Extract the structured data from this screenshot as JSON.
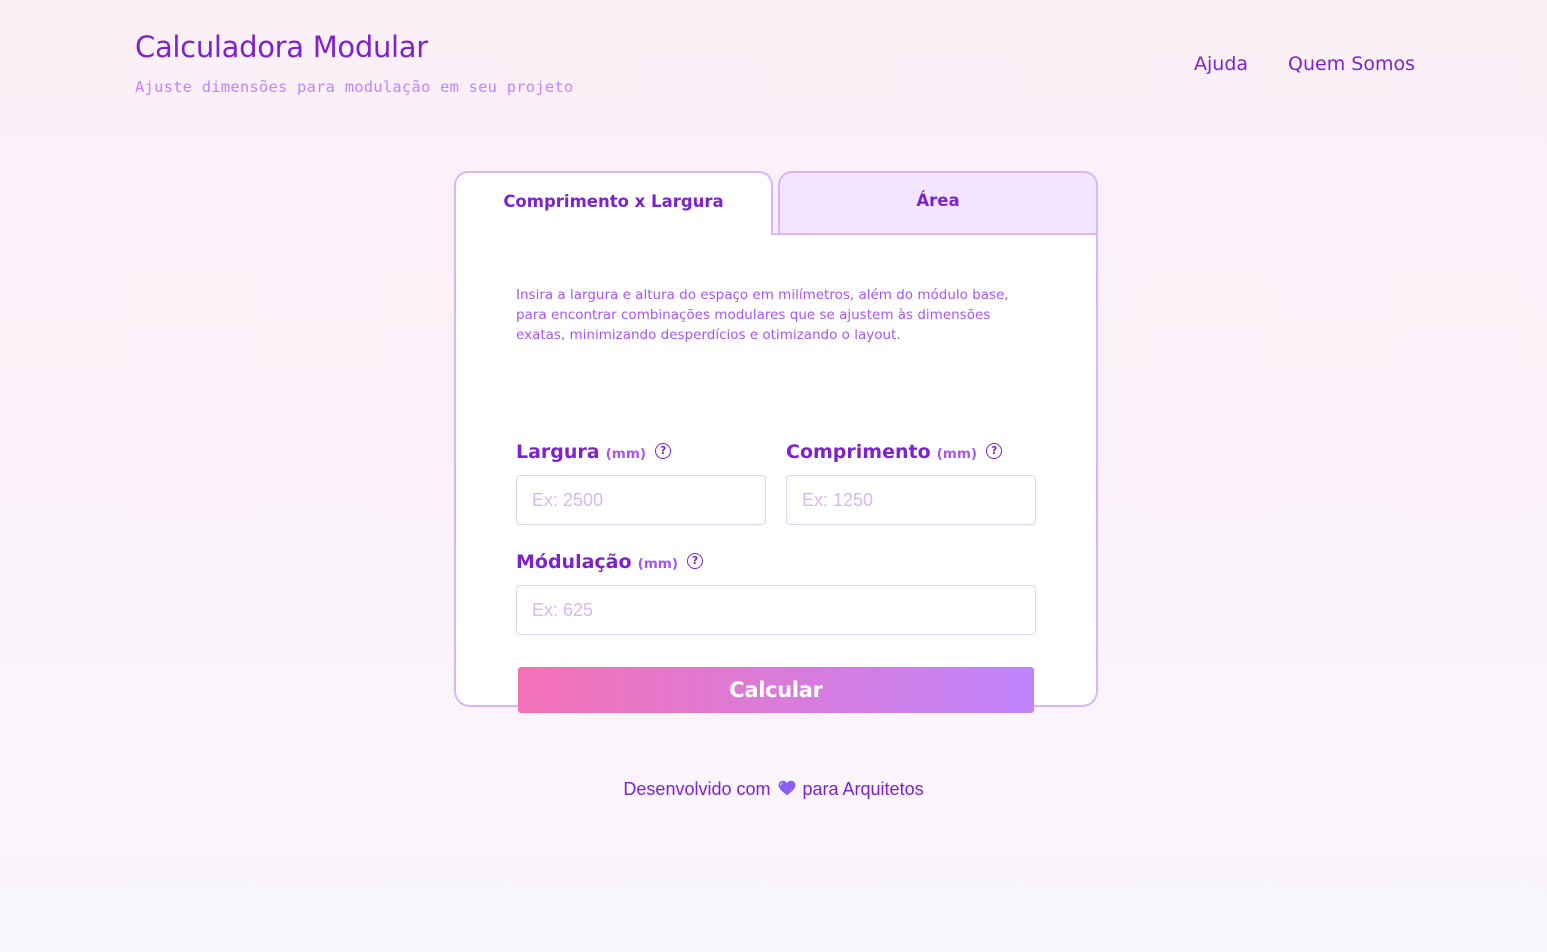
{
  "header": {
    "title": "Calculadora Modular",
    "subtitle": "Ajuste dimensões para modulação em seu projeto",
    "nav": [
      {
        "label": "Ajuda"
      },
      {
        "label": "Quem Somos"
      }
    ]
  },
  "tabs": [
    {
      "label": "Comprimento x Largura",
      "active": true
    },
    {
      "label": "Área",
      "active": false
    }
  ],
  "form": {
    "description": "Insira a largura e altura do espaço em milímetros, além do módulo base, para encontrar combinações modulares que se ajustem às dimensões exatas, minimizando desperdícios e otimizando o layout.",
    "fields": {
      "largura": {
        "label": "Largura",
        "unit": "(mm)",
        "placeholder": "Ex: 2500",
        "value": ""
      },
      "comprimento": {
        "label": "Comprimento",
        "unit": "(mm)",
        "placeholder": "Ex: 1250",
        "value": ""
      },
      "modulacao": {
        "label": "Módulação",
        "unit": "(mm)",
        "placeholder": "Ex: 625",
        "value": ""
      }
    },
    "help_glyph": "?",
    "submit_label": "Calcular"
  },
  "footer": {
    "before": "Desenvolvido com",
    "icon": "purple-heart-icon",
    "after": "para Arquitetos"
  },
  "colors": {
    "primary": "#7e22ce",
    "accent_light": "#c084fc",
    "border": "#d8b4fe",
    "tab_inactive_bg": "#f3e5ff",
    "gradient_start": "#f472b6",
    "gradient_end": "#c084fc"
  }
}
